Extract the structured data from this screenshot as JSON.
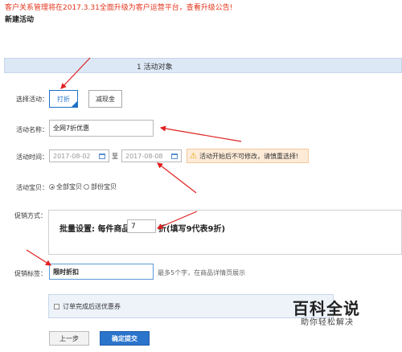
{
  "notice": "客户关系管理将在2017.3.31全面升级为客户运营平台，查看升级公告!",
  "page_title": "新建活动",
  "step": {
    "number": "1",
    "label": "活动对象"
  },
  "form": {
    "activity_type": {
      "label": "选择活动：",
      "options": [
        "打折",
        "减现金"
      ],
      "selected": "打折"
    },
    "activity_name": {
      "label": "活动名称：",
      "value": "全网7折优惠"
    },
    "activity_time": {
      "label": "活动时间：",
      "start": "2017-08-02",
      "separator": "至",
      "end": "2017-08-08",
      "warning": "活动开始后不可修改，请慎重选择!"
    },
    "activity_items": {
      "label": "活动宝贝：",
      "options": [
        "全部宝贝",
        "部份宝贝"
      ],
      "selected": "全部宝贝"
    },
    "promotion": {
      "label": "促销方式：",
      "prefix": "批量设置: 每件商品",
      "value": "7",
      "suffix": "折(填写9代表9折)"
    },
    "promo_tag": {
      "label": "促销标签：",
      "value": "限时折扣",
      "hint": "最多5个字，在商品详情页展示"
    },
    "coupon_checkbox": {
      "label": "订单完成后送优惠券",
      "checked": false
    }
  },
  "buttons": {
    "prev": "上一步",
    "submit": "确定提交"
  },
  "watermark": {
    "logo": "百科全说",
    "sub": "助你轻松解决"
  },
  "colors": {
    "accent": "#1e6fc8",
    "notice": "#e2331a",
    "arrow": "#e02020",
    "warning_bg": "#fdebd8"
  }
}
